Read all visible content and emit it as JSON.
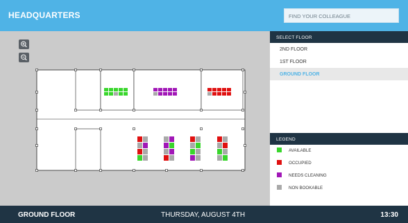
{
  "header": {
    "title": "HEADQUARTERS",
    "search_placeholder": "FIND YOUR COLLEAGUE"
  },
  "map": {
    "zoom_in_icon": "zoom-in-icon",
    "zoom_out_icon": "zoom-out-icon"
  },
  "floors": {
    "heading": "SELECT FLOOR",
    "items": [
      {
        "label": "2ND FLOOR",
        "active": false
      },
      {
        "label": "1ST FLOOR",
        "active": false
      },
      {
        "label": "GROUND FLOOR",
        "active": true
      }
    ]
  },
  "legend": {
    "heading": "LEGEND",
    "items": [
      {
        "label": "AVAILABLE",
        "color": "#39d62c"
      },
      {
        "label": "OCCUPIED",
        "color": "#e01010"
      },
      {
        "label": "NEEDS CLEANING",
        "color": "#a117b7"
      },
      {
        "label": "NON BOOKABLE",
        "color": "#a9a9a9"
      }
    ]
  },
  "footer": {
    "floor": "GROUND FLOOR",
    "date": "THURSDAY, AUGUST 4TH",
    "time": "13:30"
  },
  "colors": {
    "accent": "#4fb3e6",
    "dark": "#1f3444"
  }
}
